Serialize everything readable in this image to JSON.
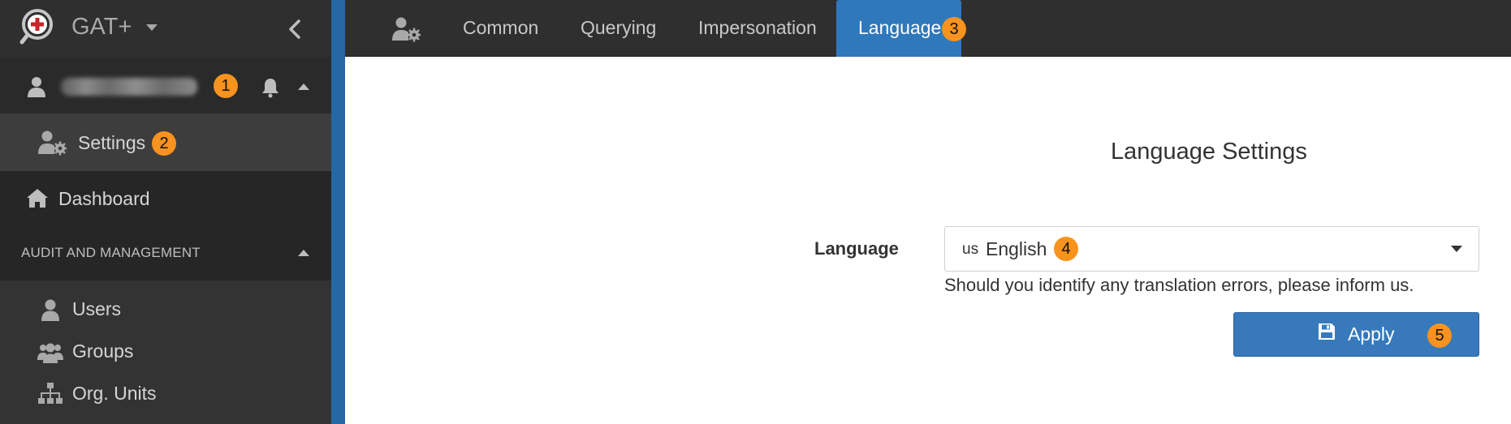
{
  "app": {
    "brand": "GAT+",
    "colors": {
      "sidebar_bg": "#2f2f2f",
      "accent": "#2f78bc",
      "badge": "#f7931e",
      "button": "#3779bb"
    }
  },
  "sidebar": {
    "user": {
      "name_blurred": true,
      "badge": "1"
    },
    "settings": {
      "label": "Settings",
      "badge": "2"
    },
    "dashboard": {
      "label": "Dashboard"
    },
    "section": {
      "label": "AUDIT AND MANAGEMENT"
    },
    "items": [
      {
        "label": "Users",
        "icon": "user-icon"
      },
      {
        "label": "Groups",
        "icon": "users-group-icon"
      },
      {
        "label": "Org. Units",
        "icon": "sitemap-icon"
      }
    ]
  },
  "topnav": {
    "tabs": [
      {
        "label": "Common"
      },
      {
        "label": "Querying"
      },
      {
        "label": "Impersonation"
      },
      {
        "label": "Language",
        "active": true,
        "badge": "3"
      }
    ]
  },
  "main": {
    "title": "Language Settings",
    "field_label": "Language",
    "select": {
      "flag": "us",
      "value": "English",
      "badge": "4"
    },
    "help_text": "Should you identify any translation errors, please inform us.",
    "apply": {
      "label": "Apply",
      "badge": "5"
    }
  }
}
